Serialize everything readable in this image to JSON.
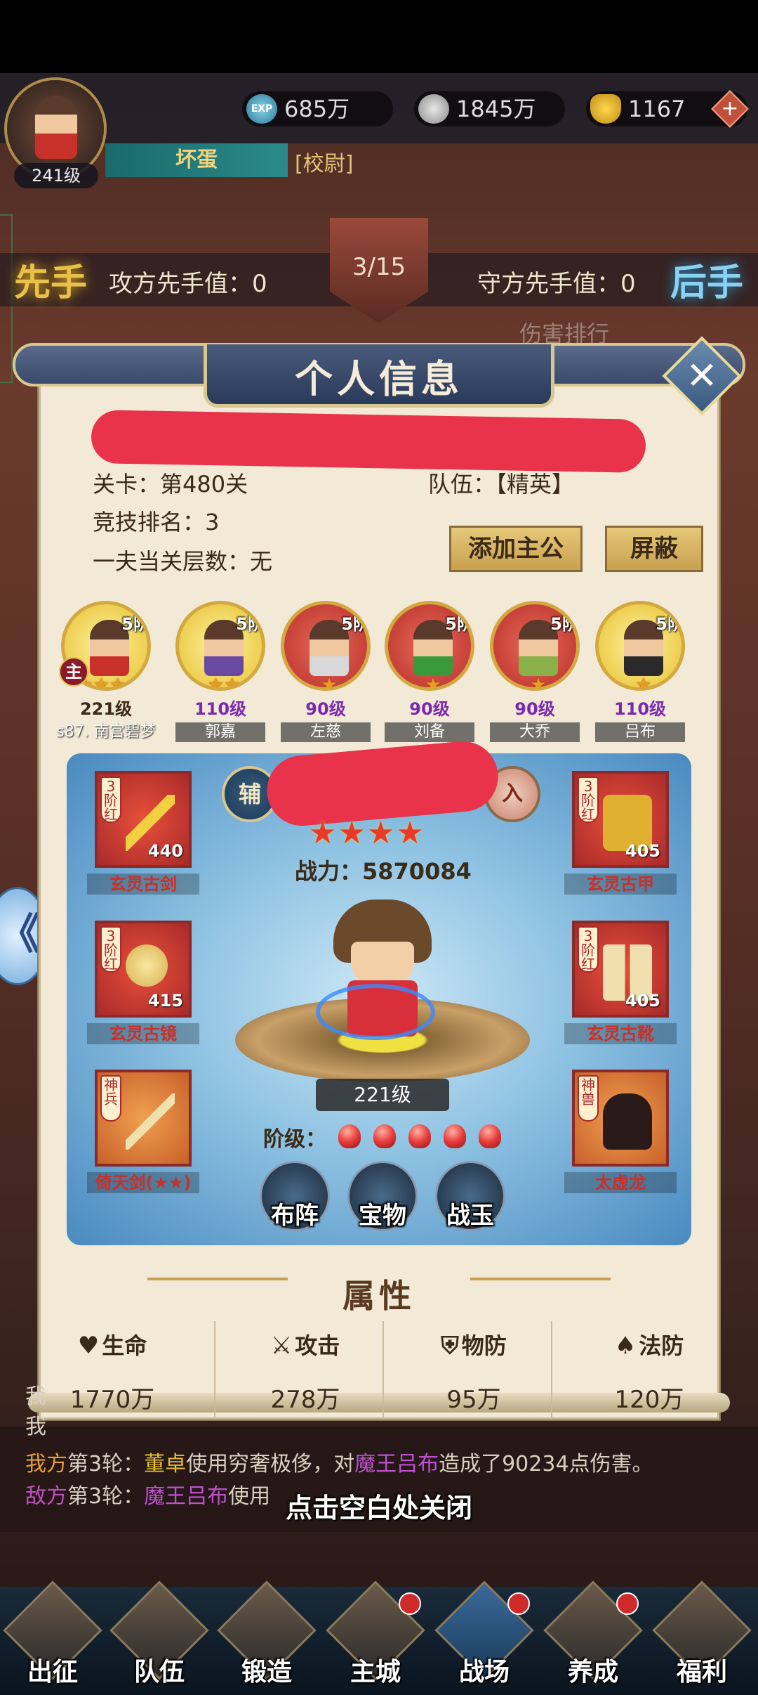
{
  "player": {
    "level": "241级",
    "name": "坏蛋",
    "title": "[校尉]"
  },
  "resources": {
    "exp_badge": "EXP",
    "exp": "685万",
    "coins": "1845万",
    "gold": "1167",
    "gold_plus": "+"
  },
  "battle": {
    "first_left": "先手",
    "first_right": "后手",
    "attack_label": "攻方先手值：0",
    "defense_label": "守方先手值：0",
    "round": "3/15",
    "damage_rank": "伤害排行"
  },
  "modal": {
    "title": "个人信息",
    "close": "✕",
    "stage": "关卡：第480关",
    "arena_rank": "竞技排名：3",
    "tower": "一夫当关层数：无",
    "rank_suffix": "队伍：【精英】",
    "add_lord": "添加主公",
    "block": "屏蔽"
  },
  "heroes": [
    {
      "tier": "5阶",
      "stars": "★★★★",
      "level": "221级",
      "name": "s87. 南宫碧梦",
      "frame": "gold",
      "level_color": "#3a2a18",
      "skin": "#c8302a"
    },
    {
      "tier": "5阶",
      "stars": "★★",
      "level": "110级",
      "name": "郭嘉",
      "frame": "gold",
      "level_color": "#7a2ab0",
      "skin": "#6a4aa0"
    },
    {
      "tier": "5阶",
      "stars": "★",
      "level": "90级",
      "name": "左慈",
      "frame": "red",
      "level_color": "#7a2ab0",
      "skin": "#d8d8d8"
    },
    {
      "tier": "5阶",
      "stars": "★",
      "level": "90级",
      "name": "刘备",
      "frame": "red",
      "level_color": "#7a2ab0",
      "skin": "#3a9a3a"
    },
    {
      "tier": "5阶",
      "stars": "★",
      "level": "90级",
      "name": "大乔",
      "frame": "red",
      "level_color": "#7a2ab0",
      "skin": "#8ab04a"
    },
    {
      "tier": "5阶",
      "stars": "★",
      "level": "110级",
      "name": "吕布",
      "frame": "gold",
      "level_color": "#7a2ab0",
      "skin": "#2a2a2a"
    }
  ],
  "main_badge": "主",
  "panel": {
    "fu": "辅",
    "ru": "入",
    "stars": "★★★★",
    "power": "战力：5870084",
    "char_level": "221级",
    "grade_label": "阶级：",
    "gems": 5
  },
  "equipment": {
    "weapon": {
      "tag": "3阶红",
      "count": "440",
      "name": "玄灵古剑"
    },
    "armor": {
      "tag": "3阶红",
      "count": "405",
      "name": "玄灵古甲"
    },
    "mirror": {
      "tag": "3阶红",
      "count": "415",
      "name": "玄灵古镜"
    },
    "boots": {
      "tag": "3阶红",
      "count": "405",
      "name": "玄灵古靴"
    },
    "divine_weapon": {
      "tag": "神兵",
      "name": "倚天剑(★★)"
    },
    "divine_beast": {
      "tag": "神兽",
      "name": "太虚龙"
    }
  },
  "functions": {
    "formation": "布阵",
    "treasure": "宝物",
    "jade": "战玉"
  },
  "attributes": {
    "title": "属性",
    "items": [
      {
        "icon": "heart-icon",
        "glyph": "♥",
        "label": "生命",
        "value": "1770万"
      },
      {
        "icon": "swords-icon",
        "glyph": "⚔",
        "label": "攻击",
        "value": "278万"
      },
      {
        "icon": "armor-icon",
        "glyph": "⛨",
        "label": "物防",
        "value": "95万"
      },
      {
        "icon": "magic-shield-icon",
        "glyph": "♠",
        "label": "法防",
        "value": "120万"
      }
    ]
  },
  "log": {
    "line1_prefix": "我",
    "line2_prefix": "我",
    "line3": {
      "side": "我方",
      "round": "第3轮：",
      "actor": "董卓",
      "mid": "使用穷奢极侈，对",
      "target": "魔王吕布",
      "tail": "造成了90234点伤害。"
    },
    "line4": {
      "side": "敌方",
      "round": "第3轮：",
      "actor": "魔王吕布",
      "mid": "使用"
    }
  },
  "close_hint": "点击空白处关闭",
  "nav": [
    "出征",
    "队伍",
    "锻造",
    "主城",
    "战场",
    "养成",
    "福利"
  ],
  "back_arrow": "《"
}
